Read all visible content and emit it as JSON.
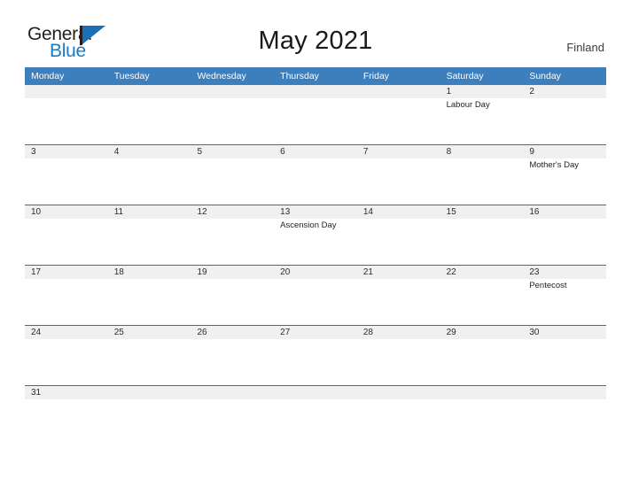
{
  "brand": {
    "name_top": "General",
    "name_bottom": "Blue",
    "accent_color": "#1a7bc4",
    "flag_icon": "blue-flag-triangle"
  },
  "header": {
    "title": "May 2021",
    "country": "Finland"
  },
  "calendar": {
    "header_color": "#3d7ebd",
    "row_divider_color": "#2f6fae",
    "number_band_color": "#f0f0f0",
    "weekdays": [
      "Monday",
      "Tuesday",
      "Wednesday",
      "Thursday",
      "Friday",
      "Saturday",
      "Sunday"
    ],
    "weeks": [
      [
        {
          "day": "",
          "event": ""
        },
        {
          "day": "",
          "event": ""
        },
        {
          "day": "",
          "event": ""
        },
        {
          "day": "",
          "event": ""
        },
        {
          "day": "",
          "event": ""
        },
        {
          "day": "1",
          "event": "Labour Day"
        },
        {
          "day": "2",
          "event": ""
        }
      ],
      [
        {
          "day": "3",
          "event": ""
        },
        {
          "day": "4",
          "event": ""
        },
        {
          "day": "5",
          "event": ""
        },
        {
          "day": "6",
          "event": ""
        },
        {
          "day": "7",
          "event": ""
        },
        {
          "day": "8",
          "event": ""
        },
        {
          "day": "9",
          "event": "Mother's Day"
        }
      ],
      [
        {
          "day": "10",
          "event": ""
        },
        {
          "day": "11",
          "event": ""
        },
        {
          "day": "12",
          "event": ""
        },
        {
          "day": "13",
          "event": "Ascension Day"
        },
        {
          "day": "14",
          "event": ""
        },
        {
          "day": "15",
          "event": ""
        },
        {
          "day": "16",
          "event": ""
        }
      ],
      [
        {
          "day": "17",
          "event": ""
        },
        {
          "day": "18",
          "event": ""
        },
        {
          "day": "19",
          "event": ""
        },
        {
          "day": "20",
          "event": ""
        },
        {
          "day": "21",
          "event": ""
        },
        {
          "day": "22",
          "event": ""
        },
        {
          "day": "23",
          "event": "Pentecost"
        }
      ],
      [
        {
          "day": "24",
          "event": ""
        },
        {
          "day": "25",
          "event": ""
        },
        {
          "day": "26",
          "event": ""
        },
        {
          "day": "27",
          "event": ""
        },
        {
          "day": "28",
          "event": ""
        },
        {
          "day": "29",
          "event": ""
        },
        {
          "day": "30",
          "event": ""
        }
      ],
      [
        {
          "day": "31",
          "event": ""
        },
        {
          "day": "",
          "event": ""
        },
        {
          "day": "",
          "event": ""
        },
        {
          "day": "",
          "event": ""
        },
        {
          "day": "",
          "event": ""
        },
        {
          "day": "",
          "event": ""
        },
        {
          "day": "",
          "event": ""
        }
      ]
    ]
  }
}
